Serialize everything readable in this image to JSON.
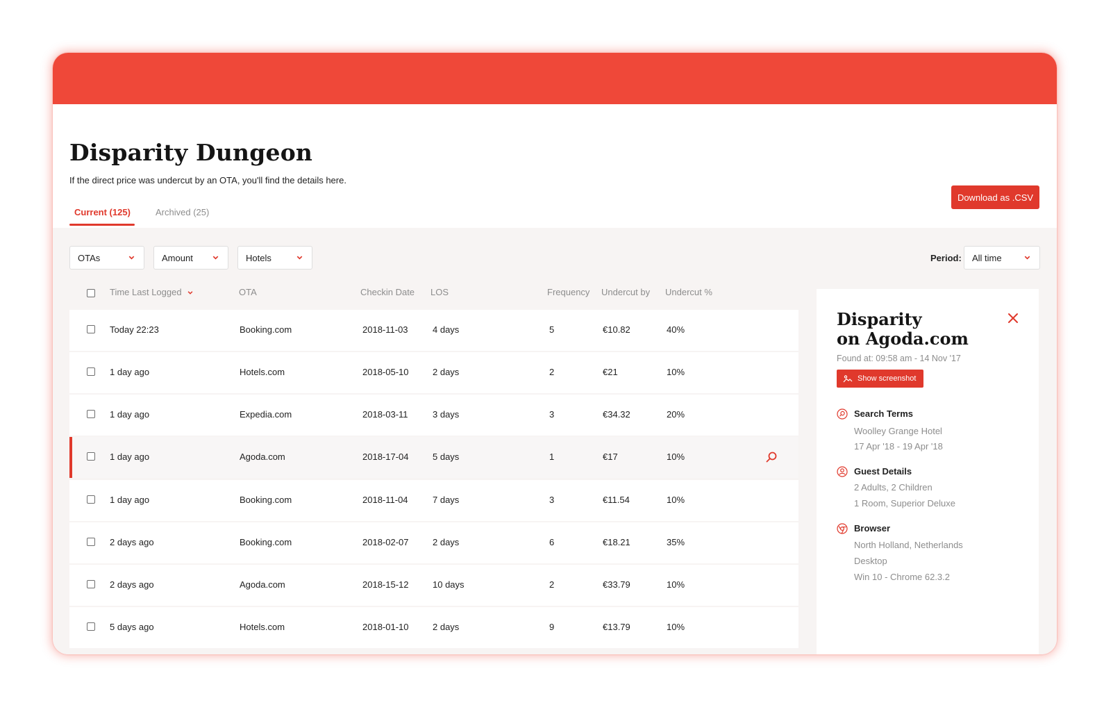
{
  "header": {
    "title": "Disparity Dungeon",
    "subtitle": "If the direct price was undercut by an OTA, you'll find the details here.",
    "download_label": "Download as .CSV"
  },
  "tabs": [
    {
      "label": "Current (125)",
      "active": true
    },
    {
      "label": "Archived (25)",
      "active": false
    }
  ],
  "filters": {
    "otas": "OTAs",
    "amount": "Amount",
    "hotels": "Hotels",
    "period_label": "Period:",
    "period_value": "All time"
  },
  "columns": {
    "time": "Time Last Logged",
    "ota": "OTA",
    "checkin": "Checkin Date",
    "los": "LOS",
    "frequency": "Frequency",
    "undercut_by": "Undercut by",
    "undercut_pct": "Undercut %"
  },
  "rows": [
    {
      "time": "Today 22:23",
      "ota": "Booking.com",
      "checkin": "2018-11-03",
      "los": "4 days",
      "frequency": "5",
      "undercut_by": "€10.82",
      "undercut_pct": "40%"
    },
    {
      "time": "1 day ago",
      "ota": "Hotels.com",
      "checkin": "2018-05-10",
      "los": "2 days",
      "frequency": "2",
      "undercut_by": "€21",
      "undercut_pct": "10%"
    },
    {
      "time": "1 day ago",
      "ota": "Expedia.com",
      "checkin": "2018-03-11",
      "los": "3 days",
      "frequency": "3",
      "undercut_by": "€34.32",
      "undercut_pct": "20%"
    },
    {
      "time": "1 day ago",
      "ota": "Agoda.com",
      "checkin": "2018-17-04",
      "los": "5 days",
      "frequency": "1",
      "undercut_by": "€17",
      "undercut_pct": "10%"
    },
    {
      "time": "1 day ago",
      "ota": "Booking.com",
      "checkin": "2018-11-04",
      "los": "7 days",
      "frequency": "3",
      "undercut_by": "€11.54",
      "undercut_pct": "10%"
    },
    {
      "time": "2 days ago",
      "ota": "Booking.com",
      "checkin": "2018-02-07",
      "los": "2 days",
      "frequency": "6",
      "undercut_by": "€18.21",
      "undercut_pct": "35%"
    },
    {
      "time": "2 days ago",
      "ota": "Agoda.com",
      "checkin": "2018-15-12",
      "los": "10 days",
      "frequency": "2",
      "undercut_by": "€33.79",
      "undercut_pct": "10%"
    },
    {
      "time": "5 days ago",
      "ota": "Hotels.com",
      "checkin": "2018-01-10",
      "los": "2 days",
      "frequency": "9",
      "undercut_by": "€13.79",
      "undercut_pct": "10%"
    }
  ],
  "detail": {
    "title_line1": "Disparity",
    "title_line2": "on Agoda.com",
    "found_at": "Found at: 09:58 am - 14 Nov '17",
    "screenshot_label": "Show screenshot",
    "search_terms": {
      "title": "Search Terms",
      "lines": [
        "Woolley Grange Hotel",
        "17 Apr '18 - 19 Apr '18"
      ]
    },
    "guest_details": {
      "title": "Guest Details",
      "lines": [
        "2 Adults, 2 Children",
        "1 Room, Superior Deluxe"
      ]
    },
    "browser": {
      "title": "Browser",
      "lines": [
        "North Holland, Netherlands",
        "Desktop",
        "Win 10 - Chrome 62.3.2"
      ]
    }
  },
  "colors": {
    "accent": "#e0392c",
    "header_bar": "#ef4839",
    "muted_text": "#8d8d8d",
    "content_bg": "#f7f4f3"
  }
}
